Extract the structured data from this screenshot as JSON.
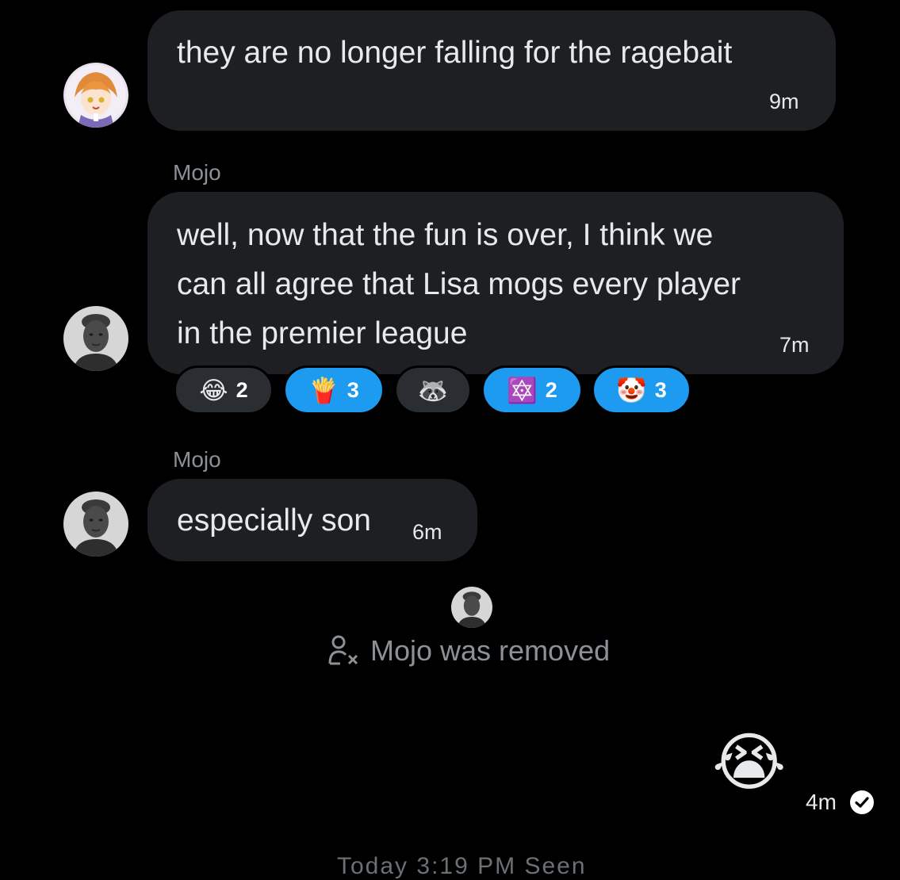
{
  "messages": [
    {
      "text": "they are no longer falling for the ragebait",
      "time": "9m",
      "avatar_icon": "anime-character-avatar"
    },
    {
      "sender": "Mojo",
      "lines": [
        "well, now that the fun is over,  I think we",
        "can all agree that Lisa mogs every player",
        "in the premier league"
      ],
      "time": "7m",
      "avatar_icon": "person-avatar",
      "reactions": [
        {
          "emoji": "😂",
          "count": "2",
          "style": "dark"
        },
        {
          "emoji": "🍟",
          "count": "3",
          "style": "blue"
        },
        {
          "emoji": "🦝",
          "count": "",
          "style": "dark"
        },
        {
          "emoji": "🔯",
          "count": "2",
          "style": "blue"
        },
        {
          "emoji": "🤡",
          "count": "3",
          "style": "blue"
        }
      ]
    },
    {
      "sender": "Mojo",
      "text": "especially son",
      "time": "6m",
      "avatar_icon": "person-avatar"
    }
  ],
  "system_event": {
    "text": "Mojo was removed",
    "icon": "user-removed-icon"
  },
  "sent_message": {
    "emoji": "😭",
    "time": "4m",
    "status_icon": "check-circle-icon"
  },
  "footer_cutoff": "Today 3:19 PM Seen",
  "colors": {
    "background": "#000000",
    "bubble": "#1d1f23",
    "accent": "#1d9bf0",
    "secondary_text": "#8b9197"
  }
}
